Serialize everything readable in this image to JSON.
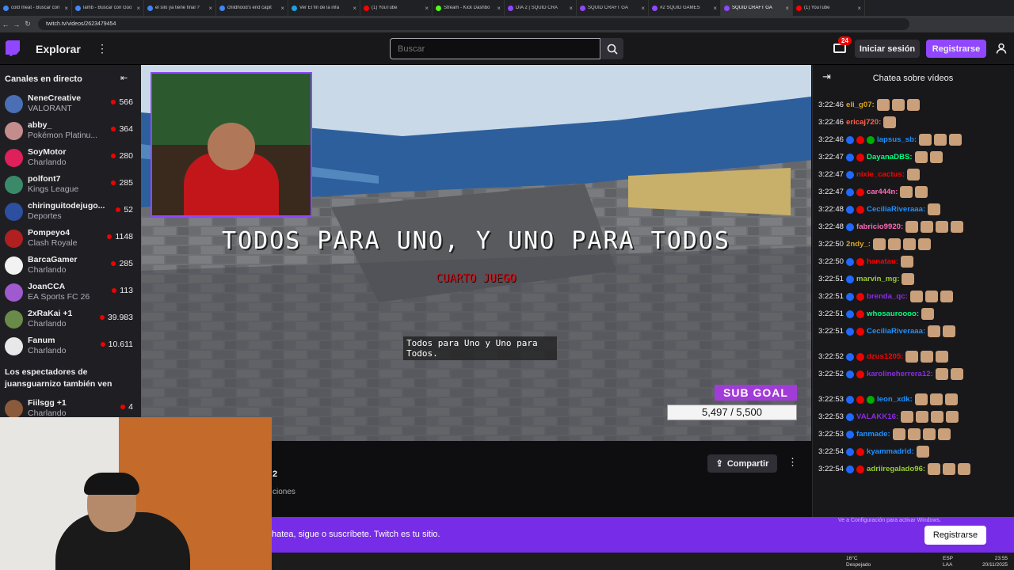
{
  "browser": {
    "tabs": [
      {
        "title": "cold meat - Buscar con",
        "color": "#4285f4"
      },
      {
        "title": "lamb - Buscar con Goo",
        "color": "#4285f4"
      },
      {
        "title": "el silo ya tiene final ?",
        "color": "#4285f4"
      },
      {
        "title": "childhood's end capit",
        "color": "#4285f4"
      },
      {
        "title": "Ver El fin de la infa",
        "color": "#1fa0e0"
      },
      {
        "title": "(1) YouTube",
        "color": "#ff0000"
      },
      {
        "title": "Stream - Kick Dashbo",
        "color": "#53fc18"
      },
      {
        "title": "DIA 2 | SQUID CRA",
        "color": "#9147ff"
      },
      {
        "title": "SQUID CRAFT GA",
        "color": "#9147ff"
      },
      {
        "title": "#2 SQUID GAMES",
        "color": "#9147ff"
      },
      {
        "title": "SQUID CRAFT GA",
        "color": "#9147ff"
      },
      {
        "title": "(1) YouTube",
        "color": "#ff0000"
      }
    ],
    "url": "twitch.tv/videos/2623479454"
  },
  "topnav": {
    "explore": "Explorar",
    "search_placeholder": "Buscar",
    "inbox_count": "24",
    "login": "Iniciar sesión",
    "register": "Registrarse"
  },
  "sidebar": {
    "title": "Canales en directo",
    "channels": [
      {
        "name": "NeneCreative",
        "game": "VALORANT",
        "viewers": "566",
        "color": "#4a6fb5"
      },
      {
        "name": "abby_",
        "game": "Pokémon Platinu...",
        "viewers": "364",
        "color": "#c48d8d"
      },
      {
        "name": "SoyMotor",
        "game": "Charlando",
        "viewers": "280",
        "color": "#e0205a"
      },
      {
        "name": "polfont7",
        "game": "Kings League",
        "viewers": "285",
        "color": "#3a8a6a"
      },
      {
        "name": "chiringuitodejugo...",
        "game": "Deportes",
        "viewers": "52",
        "color": "#2c4fa0"
      },
      {
        "name": "Pompeyo4",
        "game": "Clash Royale",
        "viewers": "1148",
        "color": "#b02020"
      },
      {
        "name": "BarcaGamer",
        "game": "Charlando",
        "viewers": "285",
        "color": "#f2f2f2"
      },
      {
        "name": "JoanCCA",
        "game": "EA Sports FC 26",
        "viewers": "113",
        "color": "#a05ad0"
      },
      {
        "name": "2xRaKai +1",
        "game": "Charlando",
        "viewers": "39.983",
        "color": "#6a8a4a"
      },
      {
        "name": "Fanum",
        "game": "Charlando",
        "viewers": "10.611",
        "color": "#e8e8e8"
      }
    ],
    "also_watch": "Los espectadores de juansguarnizo también ven",
    "also_channels": [
      {
        "name": "Fiilsgg +1",
        "game": "Charlando",
        "viewers": "4",
        "color": "#8a5a3a"
      }
    ]
  },
  "video": {
    "title_text": "TODOS PARA UNO, Y UNO PARA TODOS",
    "subtitle": "CUARTO JUEGO",
    "caption": "Todos para Uno y Uno para Todos.",
    "sub_goal_label": "SUB GOAL",
    "sub_goal_value": "5,497  / 5,500",
    "sub_goal_progress": 0.9995
  },
  "below_video": {
    "share": "Compartir",
    "stat": "2",
    "stat_label": "ciones"
  },
  "chat": {
    "title": "Chatea sobre vídeos",
    "messages": [
      {
        "ts": "3:22:46",
        "user": "eli_g07:",
        "color": "#daa520",
        "badges": 0,
        "emotes": 3
      },
      {
        "ts": "3:22:46",
        "user": "ericaj720:",
        "color": "#ff6347",
        "badges": 0,
        "emotes": 1
      },
      {
        "ts": "3:22:46",
        "user": "lapsus_sb:",
        "color": "#1e90ff",
        "badges": 3,
        "emotes": 3
      },
      {
        "ts": "3:22:47",
        "user": "DayanaDBS:",
        "color": "#00ff7f",
        "badges": 2,
        "emotes": 2
      },
      {
        "ts": "3:22:47",
        "user": "nixie_cactus:",
        "color": "#ff0000",
        "badges": 1,
        "emotes": 1
      },
      {
        "ts": "3:22:47",
        "user": "car444n:",
        "color": "#ff69b4",
        "badges": 2,
        "emotes": 2
      },
      {
        "ts": "3:22:48",
        "user": "CeciliaRiveraaa:",
        "color": "#1e90ff",
        "badges": 2,
        "emotes": 1
      },
      {
        "ts": "3:22:48",
        "user": "fabricio9920:",
        "color": "#ff69b4",
        "badges": 1,
        "emotes": 4
      },
      {
        "ts": "3:22:50",
        "user": "2ndy_:",
        "color": "#daa520",
        "badges": 0,
        "emotes": 4
      },
      {
        "ts": "3:22:50",
        "user": "hanatau:",
        "color": "#ff0000",
        "badges": 2,
        "emotes": 1
      },
      {
        "ts": "3:22:51",
        "user": "marvin_mg:",
        "color": "#9acd32",
        "badges": 1,
        "emotes": 1
      },
      {
        "ts": "3:22:51",
        "user": "brenda_qc:",
        "color": "#8a2be2",
        "badges": 2,
        "emotes": 3
      },
      {
        "ts": "3:22:51",
        "user": "whosauroooo:",
        "color": "#00ff7f",
        "badges": 2,
        "emotes": 1
      },
      {
        "ts": "3:22:51",
        "user": "CeciliaRiveraaa:",
        "color": "#1e90ff",
        "badges": 2,
        "emotes": 2
      },
      {
        "ts": "3:22:52",
        "user": "dzus1205:",
        "color": "#ff0000",
        "badges": 2,
        "emotes": 3
      },
      {
        "ts": "3:22:52",
        "user": "karolineherrera12:",
        "color": "#8a2be2",
        "badges": 2,
        "emotes": 2
      },
      {
        "ts": "3:22:53",
        "user": "leon_xdk:",
        "color": "#1e90ff",
        "badges": 3,
        "emotes": 3
      },
      {
        "ts": "3:22:53",
        "user": "VALAKK16:",
        "color": "#8a2be2",
        "badges": 1,
        "emotes": 4
      },
      {
        "ts": "3:22:53",
        "user": "fanmade:",
        "color": "#1e90ff",
        "badges": 1,
        "emotes": 4
      },
      {
        "ts": "3:22:54",
        "user": "kyammadrid:",
        "color": "#1e90ff",
        "badges": 2,
        "emotes": 1
      },
      {
        "ts": "3:22:54",
        "user": "adriiregalado96:",
        "color": "#9acd32",
        "badges": 2,
        "emotes": 3
      }
    ]
  },
  "banner": {
    "text": "hatea, sigue o suscríbete. Twitch es tu sitio.",
    "button": "Registrarse",
    "watermark": "Ve a Configuración para activar Windows."
  },
  "taskbar": {
    "temp": "16°C",
    "weather": "Despejado",
    "lang1": "ESP",
    "lang2": "LAA",
    "time": "23:55",
    "date": "20/11/2025"
  }
}
